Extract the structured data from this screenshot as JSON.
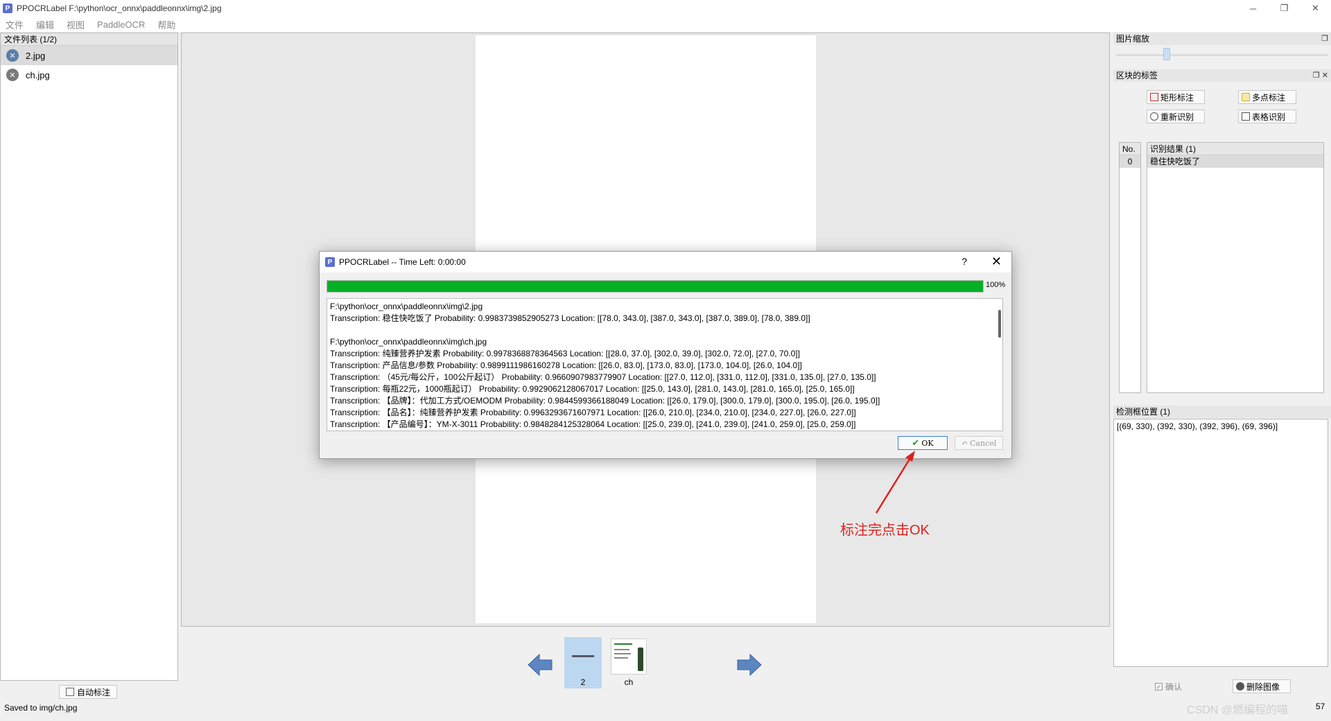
{
  "window": {
    "title": "PPOCRLabel F:\\python\\ocr_onnx\\paddleonnx\\img\\2.jpg",
    "app_icon": "P",
    "controls": {
      "minimize": "─",
      "restore": "❐",
      "close": "✕"
    }
  },
  "menu": [
    "文件",
    "编辑",
    "视图",
    "PaddleOCR",
    "帮助"
  ],
  "file_list": {
    "header": "文件列表 (1/2)",
    "items": [
      {
        "name": "2.jpg",
        "selected": true
      },
      {
        "name": "ch.jpg",
        "selected": false
      }
    ]
  },
  "left_bottom": {
    "auto_label_button": "自动标注",
    "status": "Saved to  img/ch.jpg"
  },
  "thumbnails": [
    {
      "label": "2",
      "selected": true
    },
    {
      "label": "ch",
      "selected": false
    }
  ],
  "right": {
    "zoom_header": "图片缩放",
    "zoom_level": 0.2,
    "block_label_header": "区块的标签",
    "buttons": {
      "rect": "矩形标注",
      "poly": "多点标注",
      "reocr": "重新识别",
      "table": "表格识别"
    },
    "results": {
      "no_header": "No.",
      "text_header": "识别结果 (1)",
      "rows": [
        {
          "no": "0",
          "text": "稳住快吃饭了"
        }
      ]
    },
    "boxpos": {
      "header": "检测框位置 (1)",
      "value": "[(69, 330), (392, 330), (392, 396), (69, 396)]"
    },
    "confirm": "确认",
    "delete_image": "删除图像",
    "corner_text": "57"
  },
  "dialog": {
    "title": "PPOCRLabel  --  Time Left: 0:00:00",
    "help": "?",
    "close": "✕",
    "progress": 1.0,
    "progress_text": "100%",
    "log": [
      "F:\\python\\ocr_onnx\\paddleonnx\\img\\2.jpg",
      "Transcription: 稳住快吃饭了 Probability: 0.9983739852905273 Location: [[78.0, 343.0], [387.0, 343.0], [387.0, 389.0], [78.0, 389.0]]",
      "",
      "F:\\python\\ocr_onnx\\paddleonnx\\img\\ch.jpg",
      "Transcription: 纯臻营养护发素 Probability: 0.9978368878364563 Location: [[28.0, 37.0], [302.0, 39.0], [302.0, 72.0], [27.0, 70.0]]",
      "Transcription: 产品信息/参数 Probability: 0.9899111986160278 Location: [[26.0, 83.0], [173.0, 83.0], [173.0, 104.0], [26.0, 104.0]]",
      "Transcription: （45元/每公斤，100公斤起订） Probability: 0.9660907983779907 Location: [[27.0, 112.0], [331.0, 112.0], [331.0, 135.0], [27.0, 135.0]]",
      "Transcription: 每瓶22元，1000瓶起订） Probability: 0.9929062128067017 Location: [[25.0, 143.0], [281.0, 143.0], [281.0, 165.0], [25.0, 165.0]]",
      "Transcription: 【品牌】：代加工方式/OEMODM Probability: 0.9844599366188049 Location: [[26.0, 179.0], [300.0, 179.0], [300.0, 195.0], [26.0, 195.0]]",
      "Transcription: 【品名】：纯臻营养护发素 Probability: 0.9963293671607971 Location: [[26.0, 210.0], [234.0, 210.0], [234.0, 227.0], [26.0, 227.0]]",
      "Transcription: 【产品编号】：YM-X-3011 Probability: 0.9848284125328064 Location: [[25.0, 239.0], [241.0, 239.0], [241.0, 259.0], [25.0, 259.0]]"
    ],
    "ok": "OK",
    "cancel": "Cancel"
  },
  "annotation_text": "标注完点击OK",
  "watermark": "CSDN @燃编程的喵",
  "colors": {
    "progress": "#06b025",
    "annotation": "#e02020",
    "selected_row": "#dcdcdc"
  }
}
